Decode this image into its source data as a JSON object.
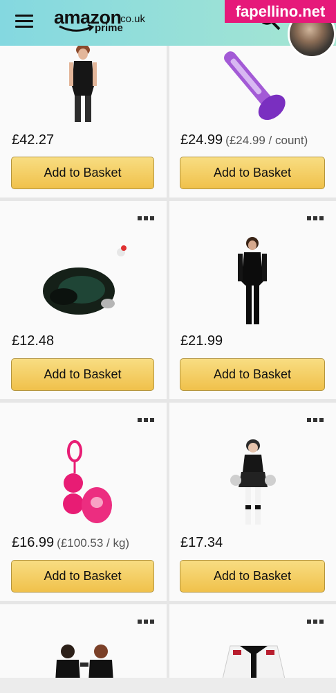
{
  "watermark": "fapellino.net",
  "logo": {
    "brand": "amazon",
    "domain": ".co.uk",
    "tagline": "prime"
  },
  "colors": {
    "header_start": "#84d8e0",
    "header_end": "#a6e6d2",
    "button": "#f0c14b",
    "watermark_bg": "#e6197a"
  },
  "products": [
    {
      "price": "£42.27",
      "unit_price": "",
      "button_label": "Add to Basket",
      "image": "lingerie-bodysuit"
    },
    {
      "price": "£24.99",
      "unit_price": "(£24.99 / count)",
      "button_label": "Add to Basket",
      "image": "wand-massager"
    },
    {
      "price": "£12.48",
      "unit_price": "",
      "button_label": "Add to Basket",
      "image": "fox-tail-plug"
    },
    {
      "price": "£21.99",
      "unit_price": "",
      "button_label": "Add to Basket",
      "image": "black-catsuit"
    },
    {
      "price": "£16.99",
      "unit_price": "(£100.53 / kg)",
      "button_label": "Add to Basket",
      "image": "pink-love-balls"
    },
    {
      "price": "£17.34",
      "unit_price": "",
      "button_label": "Add to Basket",
      "image": "cheerleader-costume"
    },
    {
      "image": "devil-costume-couple"
    },
    {
      "image": "schoolgirl-costume"
    }
  ]
}
